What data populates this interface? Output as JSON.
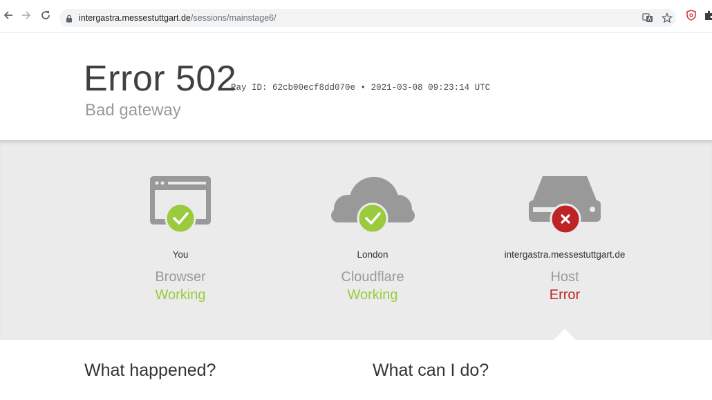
{
  "browser": {
    "url_host": "intergastra.messestuttgart.de",
    "url_path": "/sessions/mainstage6/",
    "icons": [
      "back-icon",
      "forward-icon",
      "reload-icon",
      "lock-icon",
      "translate-icon",
      "star-icon",
      "extension-shield-icon",
      "extensions-puzzle-icon"
    ]
  },
  "error": {
    "code": "Error 502",
    "ray": "Ray ID: 62cb00ecf8dd070e",
    "bullet": "•",
    "timestamp": "2021-03-08 09:23:14 UTC",
    "subtitle": "Bad gateway"
  },
  "status": [
    {
      "location": "You",
      "kind": "Browser",
      "state": "Working",
      "icon": "browser-window-icon",
      "badge": "check"
    },
    {
      "location": "London",
      "kind": "Cloudflare",
      "state": "Working",
      "icon": "cloud-icon",
      "badge": "check"
    },
    {
      "location": "intergastra.messestuttgart.de",
      "kind": "Host",
      "state": "Error",
      "icon": "server-icon",
      "badge": "cross"
    }
  ],
  "sections": {
    "what_happened": "What happened?",
    "what_can_i_do": "What can I do?"
  },
  "colors": {
    "working": "#9bca3e",
    "error": "#bd2426",
    "icon_gray": "#999999",
    "band_bg": "#ebebeb"
  }
}
